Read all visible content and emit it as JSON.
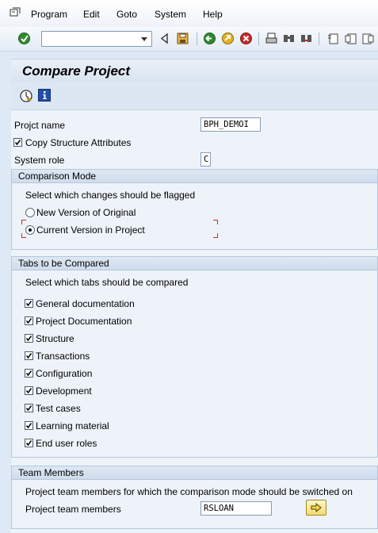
{
  "menu": {
    "items": [
      {
        "label": "Program"
      },
      {
        "label": "Edit"
      },
      {
        "label": "Goto"
      },
      {
        "label": "System"
      },
      {
        "label": "Help"
      }
    ]
  },
  "toolbar": {
    "command_value": "",
    "icons": [
      "enter-icon",
      "back-icon",
      "save-icon",
      "back-green-icon",
      "exit-icon",
      "cancel-icon",
      "print-icon",
      "find-icon",
      "find-next-icon",
      "first-page-icon",
      "prev-page-icon",
      "next-page-icon"
    ]
  },
  "title": "Compare Project",
  "app_toolbar": {
    "icons": [
      "execute-clock-icon",
      "info-icon"
    ]
  },
  "form": {
    "project_name_label": "Projct name",
    "project_name_value": "BPH_DEMOI",
    "copy_structure_label": "Copy Structure Attributes",
    "copy_structure_checked": true,
    "system_role_label": "System role",
    "system_role_value": "C"
  },
  "comparison_mode": {
    "header": "Comparison Mode",
    "instruction": "Select which changes should be flagged",
    "options": [
      {
        "label": "New Version of Original",
        "selected": false
      },
      {
        "label": "Current Version in Project",
        "selected": true
      }
    ]
  },
  "tabs_compared": {
    "header": "Tabs to be Compared",
    "instruction": "Select which tabs should be compared",
    "items": [
      {
        "label": "General documentation",
        "checked": true
      },
      {
        "label": "Project Documentation",
        "checked": true
      },
      {
        "label": "Structure",
        "checked": true
      },
      {
        "label": "Transactions",
        "checked": true
      },
      {
        "label": "Configuration",
        "checked": true
      },
      {
        "label": "Development",
        "checked": true
      },
      {
        "label": "Test cases",
        "checked": true
      },
      {
        "label": "Learning material",
        "checked": true
      },
      {
        "label": "End user roles",
        "checked": true
      }
    ]
  },
  "team_members": {
    "header": "Team Members",
    "instruction": "Project team members for which  the comparison mode should be switched on",
    "field_label": "Project team members",
    "field_value": "RSLOAN"
  },
  "colors": {
    "background": "#dfe9f5",
    "panel": "#eef3fa",
    "group_border": "#b7c6d8"
  }
}
